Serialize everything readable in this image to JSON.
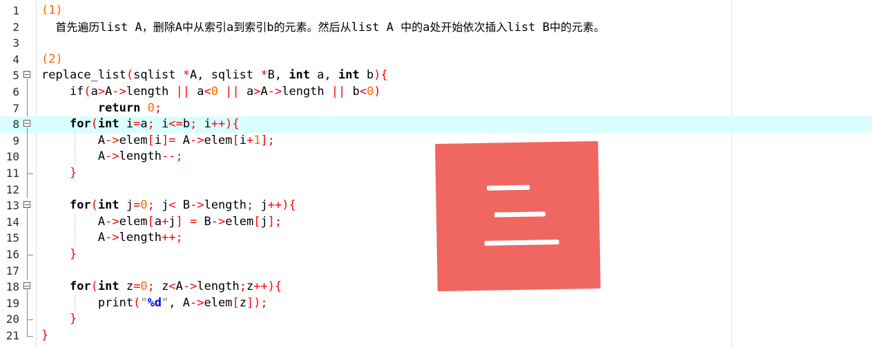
{
  "editor": {
    "lines": [
      {
        "n": "1",
        "tokens": [
          [
            "t-num",
            "(1)"
          ]
        ]
      },
      {
        "n": "2",
        "tokens": [
          [
            "t-id cjk",
            "    首先遍历"
          ],
          [
            "t-id",
            "list A"
          ],
          [
            "t-id cjk",
            "，删除"
          ],
          [
            "t-id",
            "A"
          ],
          [
            "t-id cjk",
            "中从索引"
          ],
          [
            "t-id",
            "a"
          ],
          [
            "t-id cjk",
            "到索引"
          ],
          [
            "t-id",
            "b"
          ],
          [
            "t-id cjk",
            "的元素。然后从"
          ],
          [
            "t-id",
            "list A "
          ],
          [
            "t-id cjk",
            "中的"
          ],
          [
            "t-id",
            "a"
          ],
          [
            "t-id cjk",
            "处开始依次插入"
          ],
          [
            "t-id",
            "list B"
          ],
          [
            "t-id cjk",
            "中的元素。"
          ]
        ]
      },
      {
        "n": "3",
        "tokens": []
      },
      {
        "n": "4",
        "tokens": [
          [
            "t-num",
            "(2)"
          ]
        ]
      },
      {
        "n": "5",
        "tokens": [
          [
            "t-id",
            "replace_list"
          ],
          [
            "t-op",
            "("
          ],
          [
            "t-id",
            "sqlist "
          ],
          [
            "t-op",
            "*"
          ],
          [
            "t-id",
            "A, sqlist "
          ],
          [
            "t-op",
            "*"
          ],
          [
            "t-id",
            "B, "
          ],
          [
            "t-kw",
            "int"
          ],
          [
            "t-id",
            " a, "
          ],
          [
            "t-kw",
            "int"
          ],
          [
            "t-id",
            " b"
          ],
          [
            "t-op",
            "){"
          ]
        ]
      },
      {
        "n": "6",
        "tokens": [
          [
            "t-id",
            "    if"
          ],
          [
            "t-op",
            "("
          ],
          [
            "t-id",
            "a"
          ],
          [
            "t-op",
            ">"
          ],
          [
            "t-id",
            "A"
          ],
          [
            "t-op",
            "->"
          ],
          [
            "t-id",
            "length "
          ],
          [
            "t-op",
            "||"
          ],
          [
            "t-id",
            " a"
          ],
          [
            "t-op",
            "<"
          ],
          [
            "t-num",
            "0"
          ],
          [
            "t-id",
            " "
          ],
          [
            "t-op",
            "||"
          ],
          [
            "t-id",
            " a"
          ],
          [
            "t-op",
            ">"
          ],
          [
            "t-id",
            "A"
          ],
          [
            "t-op",
            "->"
          ],
          [
            "t-id",
            "length "
          ],
          [
            "t-op",
            "||"
          ],
          [
            "t-id",
            " b"
          ],
          [
            "t-op",
            "<"
          ],
          [
            "t-num",
            "0"
          ],
          [
            "t-op",
            ")"
          ]
        ]
      },
      {
        "n": "7",
        "tokens": [
          [
            "t-id",
            "        "
          ],
          [
            "t-kw",
            "return"
          ],
          [
            "t-id",
            " "
          ],
          [
            "t-num",
            "0"
          ],
          [
            "t-op",
            ";"
          ]
        ]
      },
      {
        "n": "8",
        "tokens": [
          [
            "t-id",
            "    "
          ],
          [
            "t-kw",
            "for"
          ],
          [
            "t-op",
            "("
          ],
          [
            "t-kw",
            "int"
          ],
          [
            "t-id",
            " i"
          ],
          [
            "t-op",
            "="
          ],
          [
            "t-id",
            "a"
          ],
          [
            "t-op",
            ";"
          ],
          [
            "t-id",
            " i"
          ],
          [
            "t-op",
            "<="
          ],
          [
            "t-id",
            "b"
          ],
          [
            "t-op",
            ";"
          ],
          [
            "t-id",
            " i"
          ],
          [
            "t-op",
            "++){"
          ]
        ]
      },
      {
        "n": "9",
        "tokens": [
          [
            "t-id",
            "        A"
          ],
          [
            "t-op",
            "->"
          ],
          [
            "t-id",
            "elem"
          ],
          [
            "t-op",
            "["
          ],
          [
            "t-id",
            "i"
          ],
          [
            "t-op",
            "]="
          ],
          [
            "t-id",
            " A"
          ],
          [
            "t-op",
            "->"
          ],
          [
            "t-id",
            "elem"
          ],
          [
            "t-op",
            "["
          ],
          [
            "t-id",
            "i"
          ],
          [
            "t-op",
            "+"
          ],
          [
            "t-num",
            "1"
          ],
          [
            "t-op",
            "];"
          ]
        ]
      },
      {
        "n": "10",
        "tokens": [
          [
            "t-id",
            "        A"
          ],
          [
            "t-op",
            "->"
          ],
          [
            "t-id",
            "length"
          ],
          [
            "t-op",
            "--;"
          ]
        ]
      },
      {
        "n": "11",
        "tokens": [
          [
            "t-id",
            "    "
          ],
          [
            "t-op",
            "}"
          ]
        ]
      },
      {
        "n": "12",
        "tokens": []
      },
      {
        "n": "13",
        "tokens": [
          [
            "t-id",
            "    "
          ],
          [
            "t-kw",
            "for"
          ],
          [
            "t-op",
            "("
          ],
          [
            "t-kw",
            "int"
          ],
          [
            "t-id",
            " j"
          ],
          [
            "t-op",
            "="
          ],
          [
            "t-num",
            "0"
          ],
          [
            "t-op",
            ";"
          ],
          [
            "t-id",
            " j"
          ],
          [
            "t-op",
            "<"
          ],
          [
            "t-id",
            " B"
          ],
          [
            "t-op",
            "->"
          ],
          [
            "t-id",
            "length"
          ],
          [
            "t-op",
            ";"
          ],
          [
            "t-id",
            " j"
          ],
          [
            "t-op",
            "++){"
          ]
        ]
      },
      {
        "n": "14",
        "tokens": [
          [
            "t-id",
            "        A"
          ],
          [
            "t-op",
            "->"
          ],
          [
            "t-id",
            "elem"
          ],
          [
            "t-op",
            "["
          ],
          [
            "t-id",
            "a"
          ],
          [
            "t-op",
            "+"
          ],
          [
            "t-id",
            "j"
          ],
          [
            "t-op",
            "]"
          ],
          [
            "t-id",
            " "
          ],
          [
            "t-op",
            "="
          ],
          [
            "t-id",
            " B"
          ],
          [
            "t-op",
            "->"
          ],
          [
            "t-id",
            "elem"
          ],
          [
            "t-op",
            "["
          ],
          [
            "t-id",
            "j"
          ],
          [
            "t-op",
            "];"
          ]
        ]
      },
      {
        "n": "15",
        "tokens": [
          [
            "t-id",
            "        A"
          ],
          [
            "t-op",
            "->"
          ],
          [
            "t-id",
            "length"
          ],
          [
            "t-op",
            "++;"
          ]
        ]
      },
      {
        "n": "16",
        "tokens": [
          [
            "t-id",
            "    "
          ],
          [
            "t-op",
            "}"
          ]
        ]
      },
      {
        "n": "17",
        "tokens": []
      },
      {
        "n": "18",
        "tokens": [
          [
            "t-id",
            "    "
          ],
          [
            "t-kw",
            "for"
          ],
          [
            "t-op",
            "("
          ],
          [
            "t-kw",
            "int"
          ],
          [
            "t-id",
            " z"
          ],
          [
            "t-op",
            "="
          ],
          [
            "t-num",
            "0"
          ],
          [
            "t-op",
            ";"
          ],
          [
            "t-id",
            " z"
          ],
          [
            "t-op",
            "<"
          ],
          [
            "t-id",
            "A"
          ],
          [
            "t-op",
            "->"
          ],
          [
            "t-id",
            "length"
          ],
          [
            "t-op",
            ";"
          ],
          [
            "t-id",
            "z"
          ],
          [
            "t-op",
            "++){"
          ]
        ]
      },
      {
        "n": "19",
        "tokens": [
          [
            "t-id",
            "        print"
          ],
          [
            "t-op",
            "("
          ],
          [
            "t-str",
            "\""
          ],
          [
            "t-fmt",
            "%d"
          ],
          [
            "t-str",
            "\""
          ],
          [
            "t-id",
            ", A"
          ],
          [
            "t-op",
            "->"
          ],
          [
            "t-id",
            "elem"
          ],
          [
            "t-op",
            "["
          ],
          [
            "t-id",
            "z"
          ],
          [
            "t-op",
            "]);"
          ]
        ]
      },
      {
        "n": "20",
        "tokens": [
          [
            "t-id",
            "    "
          ],
          [
            "t-op",
            "}"
          ]
        ]
      },
      {
        "n": "21",
        "tokens": [
          [
            "t-op",
            "}"
          ]
        ]
      }
    ],
    "current_line": 8,
    "fold_open": [
      5,
      8,
      13,
      18
    ],
    "fold_end": [
      11,
      16,
      20,
      21
    ]
  },
  "overlay": {
    "icon": "menu-icon",
    "color": "#f06660"
  }
}
